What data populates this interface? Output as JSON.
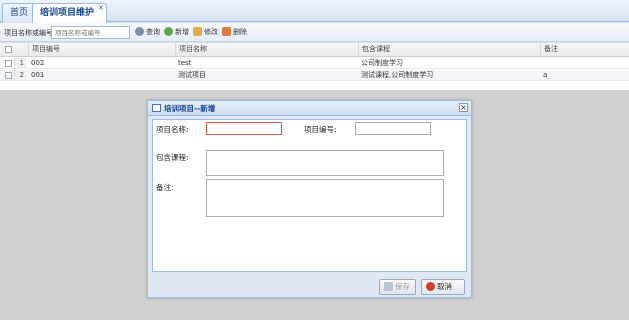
{
  "tabs": [
    {
      "label": "首页"
    },
    {
      "label": "培训项目维护"
    }
  ],
  "toolbar": {
    "search_label": "项目名称或编号",
    "search_placeholder": "项目名称或编号",
    "query": "查询",
    "add": "新增",
    "edit": "修改",
    "delete": "删除"
  },
  "grid": {
    "headers": [
      "项目编号",
      "项目名称",
      "包含课程",
      "备注"
    ],
    "rows": [
      {
        "num": "1",
        "code": "002",
        "name": "test",
        "courses": "公司制度学习",
        "remark": ""
      },
      {
        "num": "2",
        "code": "001",
        "name": "测试项目",
        "courses": "测试课程,公司制度学习",
        "remark": "a"
      }
    ]
  },
  "dialog": {
    "title": "培训项目--新增",
    "close": "×",
    "name_label": "项目名称:",
    "code_label": "项目编号:",
    "courses_label": "包含课程:",
    "remark_label": "备注:",
    "save": "保存",
    "cancel": "取消"
  }
}
